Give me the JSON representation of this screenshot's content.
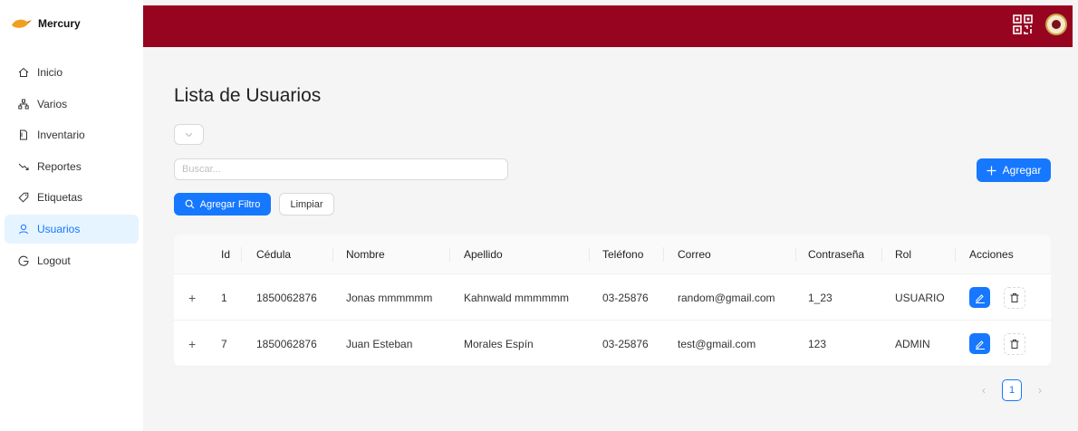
{
  "brand": {
    "name": "Mercury",
    "icon": "mercury-logo"
  },
  "sidebar": {
    "items": [
      {
        "label": "Inicio",
        "icon": "home-icon"
      },
      {
        "label": "Varios",
        "icon": "apartment-icon"
      },
      {
        "label": "Inventario",
        "icon": "file-icon"
      },
      {
        "label": "Reportes",
        "icon": "fall-chart-icon"
      },
      {
        "label": "Etiquetas",
        "icon": "tag-icon"
      },
      {
        "label": "Usuarios",
        "icon": "user-icon",
        "active": true
      },
      {
        "label": "Logout",
        "icon": "google-icon"
      }
    ]
  },
  "topbar": {
    "color": "#970420",
    "icons": [
      "qr-code-icon",
      "institution-emblem"
    ]
  },
  "main": {
    "title": "Lista de Usuarios",
    "search_placeholder": "Buscar...",
    "filter_button": "Agregar Filtro",
    "clear_button": "Limpiar",
    "add_button": "Agregar"
  },
  "table": {
    "columns": [
      "Id",
      "Cédula",
      "Nombre",
      "Apellido",
      "Teléfono",
      "Correo",
      "Contraseña",
      "Rol",
      "Acciones"
    ],
    "rows": [
      {
        "id": "1",
        "cedula": "1850062876",
        "nombre": "Jonas mmmmmm",
        "apellido": "Kahnwald mmmmmm",
        "telefono": "03-25876",
        "correo": "random@gmail.com",
        "contrasena": "1_23",
        "rol": "USUARIO"
      },
      {
        "id": "7",
        "cedula": "1850062876",
        "nombre": "Juan Esteban",
        "apellido": "Morales Espín",
        "telefono": "03-25876",
        "correo": "test@gmail.com",
        "contrasena": "123",
        "rol": "ADMIN"
      }
    ],
    "expand_symbol": "+"
  },
  "pagination": {
    "current": "1",
    "prev": "‹",
    "next": "›"
  },
  "colors": {
    "primary": "#1677ff",
    "header": "#970420",
    "active_bg": "#e6f4ff"
  }
}
